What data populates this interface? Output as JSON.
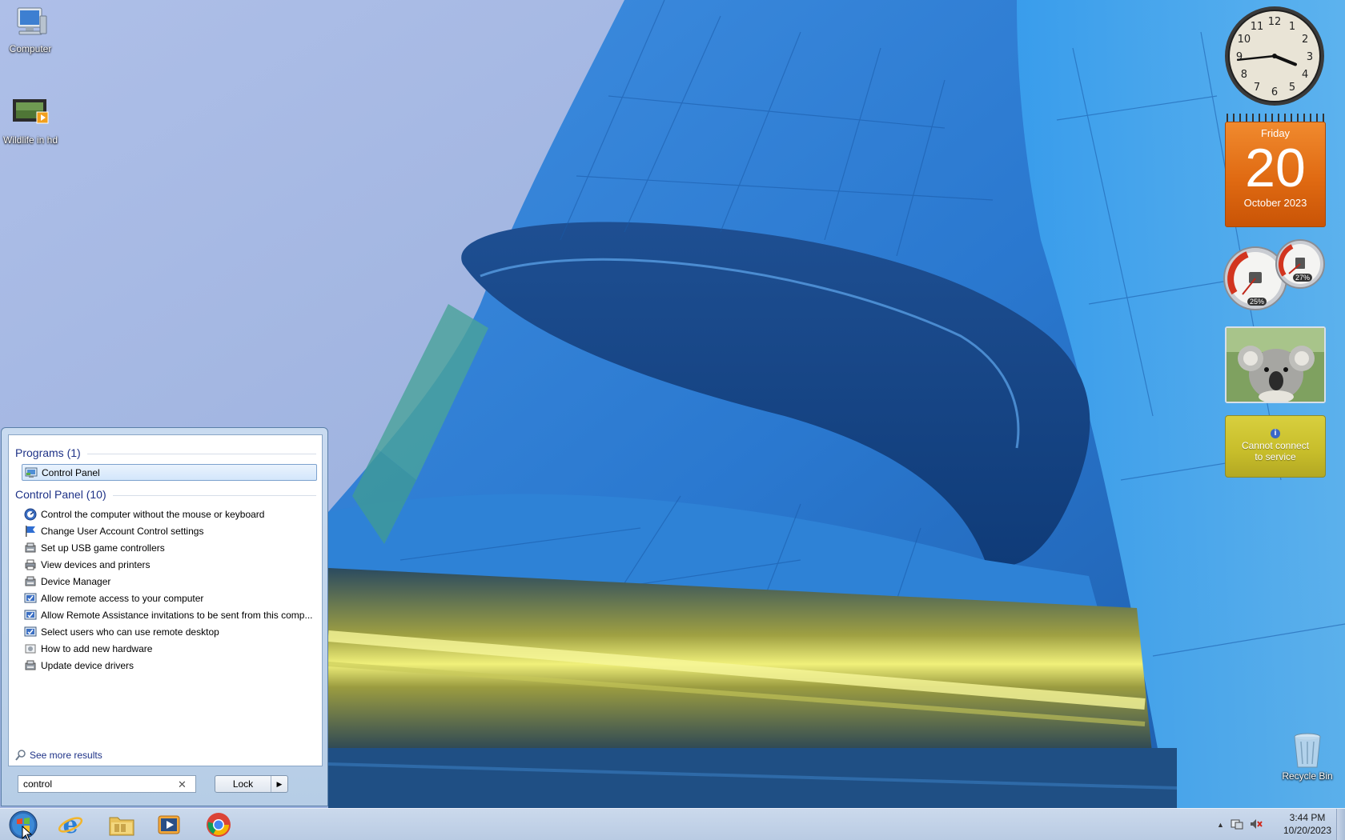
{
  "desktop": {
    "icons": [
      {
        "label": "Computer",
        "icon": "computer-icon"
      },
      {
        "label": "Wildlife in hd",
        "icon": "video-file-icon"
      },
      {
        "label": "Recycle Bin",
        "icon": "recycle-bin-icon"
      }
    ]
  },
  "gadgets": {
    "clock": {
      "hour": 3,
      "minute": 44
    },
    "calendar": {
      "day_name": "Friday",
      "day": "20",
      "month_year": "October 2023"
    },
    "meter": {
      "cpu": "25%",
      "memory": "27%"
    },
    "weather": {
      "message_line1": "Cannot connect",
      "message_line2": "to service"
    }
  },
  "start_menu": {
    "programs_header": "Programs (1)",
    "programs": [
      {
        "label": "Control Panel",
        "icon": "control-panel-icon",
        "selected": true
      }
    ],
    "cp_header": "Control Panel (10)",
    "cp_items": [
      {
        "label": "Control the computer without the mouse or keyboard",
        "icon": "ease-of-access-icon"
      },
      {
        "label": "Change User Account Control settings",
        "icon": "uac-flag-icon"
      },
      {
        "label": "Set up USB game controllers",
        "icon": "devices-icon"
      },
      {
        "label": "View devices and printers",
        "icon": "printer-icon"
      },
      {
        "label": "Device Manager",
        "icon": "devices-icon"
      },
      {
        "label": "Allow remote access to your computer",
        "icon": "system-icon"
      },
      {
        "label": "Allow Remote Assistance invitations to be sent from this comp...",
        "icon": "system-icon"
      },
      {
        "label": "Select users who can use remote desktop",
        "icon": "system-icon"
      },
      {
        "label": "How to add new hardware",
        "icon": "help-icon"
      },
      {
        "label": "Update device drivers",
        "icon": "devices-icon"
      }
    ],
    "see_more": "See more results",
    "search_value": "control",
    "clear_symbol": "✕",
    "lock_label": "Lock",
    "lock_arrow": "▶"
  },
  "taskbar": {
    "time": "3:44 PM",
    "date": "10/20/2023",
    "tray_expand": "▲"
  }
}
